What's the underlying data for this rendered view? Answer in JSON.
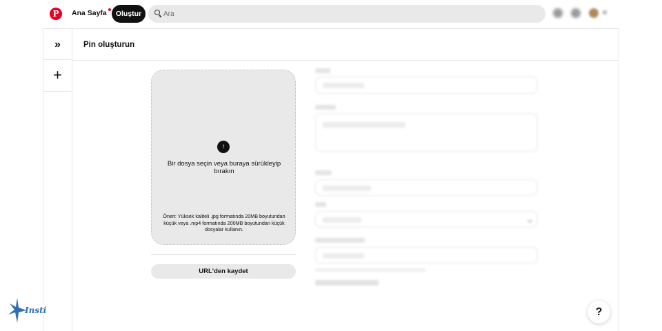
{
  "header": {
    "logo": "P",
    "home_label": "Ana Sayfa",
    "create_label": "Oluştur",
    "search_placeholder": "Ara"
  },
  "sidebar": {
    "expand_glyph": "»",
    "add_glyph": "+"
  },
  "page": {
    "title": "Pin oluşturun"
  },
  "upload": {
    "icon_glyph": "↑",
    "title": "Bir dosya seçin veya buraya sürükleyip bırakın",
    "hint": "Öneri: Yüksek kaliteli .jpg formatında 20MB boyutundan küçük veya .mp4 formatında 200MB boyutundan küçük dosyalar kullanın.",
    "url_button": "URL'den kaydet"
  },
  "help": {
    "label": "?"
  },
  "colors": {
    "brand": "#e60023",
    "dark": "#111111",
    "surface": "#e9e9e9"
  },
  "icons": [
    "pinterest-logo-icon",
    "search-icon",
    "notifications-icon",
    "messages-icon",
    "avatar",
    "chevron-down-icon",
    "expand-icon",
    "plus-icon",
    "upload-arrow-icon",
    "help-icon"
  ]
}
